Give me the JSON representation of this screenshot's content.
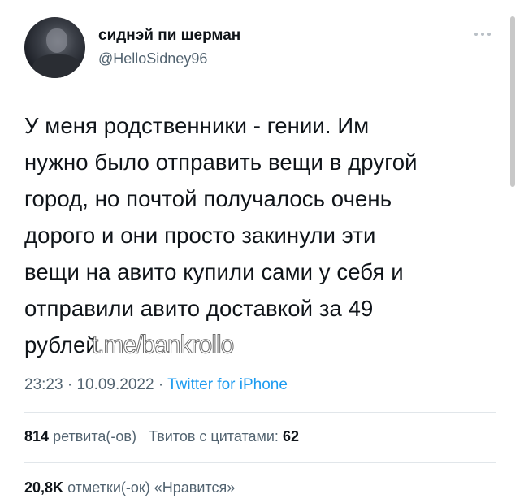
{
  "author": {
    "display_name": "сиднэй пи шерман",
    "handle": "@HelloSidney96"
  },
  "tweet": {
    "lines": [
      "У меня родственники - гении. Им",
      "нужно было отправить вещи в другой",
      "город, но почтой получалось очень",
      "дорого и они просто закинули эти",
      "вещи на авито купили сами у себя и",
      "отправили авито доставкой за 49",
      "рублей"
    ],
    "watermark": "t.me/bankrollo"
  },
  "meta": {
    "time": "23:23",
    "dot1": "·",
    "date": "10.09.2022",
    "dot2": "·",
    "source": "Twitter for iPhone"
  },
  "stats": {
    "retweets_count": "814",
    "retweets_label": "ретвита(-ов)",
    "quotes_label": "Твитов с цитатами:",
    "quotes_count": "62",
    "likes_count": "20,8K",
    "likes_label": "отметки(-ок) «Нравится»"
  },
  "icons": {
    "more": "more-horizontal-icon"
  },
  "colors": {
    "link": "#1d9bf0",
    "secondary": "#536471",
    "primary": "#0f1419"
  }
}
